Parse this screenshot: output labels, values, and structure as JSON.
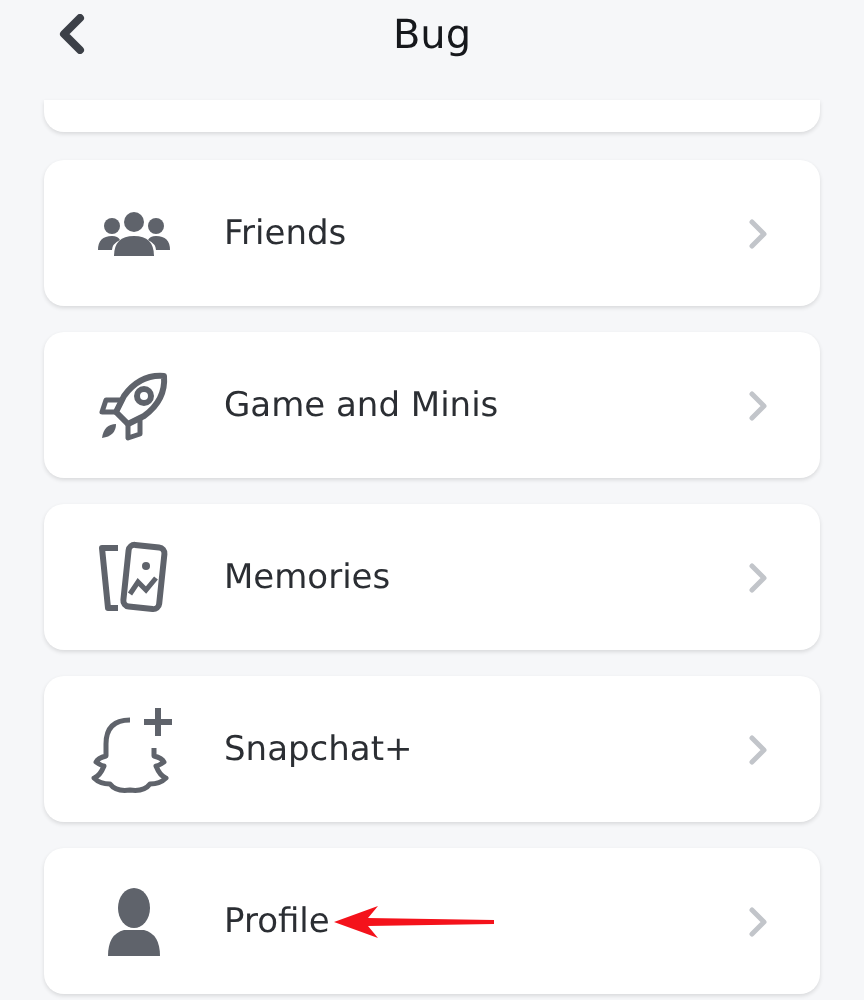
{
  "header": {
    "title": "Bug"
  },
  "items": [
    {
      "label": "Friends",
      "annotated": false
    },
    {
      "label": "Game and Minis",
      "annotated": false
    },
    {
      "label": "Memories",
      "annotated": false
    },
    {
      "label": "Snapchat+",
      "annotated": false
    },
    {
      "label": "Profile",
      "annotated": true
    }
  ]
}
